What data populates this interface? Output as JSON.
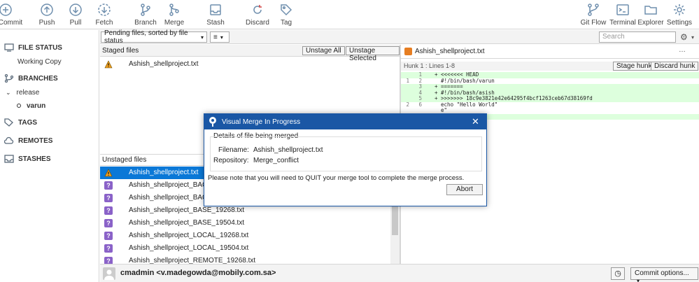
{
  "toolbar": {
    "commit": "Commit",
    "push": "Push",
    "pull": "Pull",
    "fetch": "Fetch",
    "branch": "Branch",
    "merge": "Merge",
    "stash": "Stash",
    "discard": "Discard",
    "tag": "Tag",
    "gitflow": "Git Flow",
    "terminal": "Terminal",
    "explorer": "Explorer",
    "settings": "Settings"
  },
  "sidebar": {
    "file_status": "FILE STATUS",
    "working_copy": "Working Copy",
    "branches": "BRANCHES",
    "release": "release",
    "varun": "varun",
    "tags": "TAGS",
    "remotes": "REMOTES",
    "stashes": "STASHES"
  },
  "filter": {
    "sort": "Pending files, sorted by file status",
    "search_placeholder": "Search"
  },
  "staged": {
    "header": "Staged files",
    "unstage_all": "Unstage All",
    "unstage_selected": "Unstage Selected",
    "files": [
      "Ashish_shellproject.txt"
    ]
  },
  "unstaged": {
    "header": "Unstaged files",
    "files": [
      "Ashish_shellproject.txt",
      "Ashish_shellproject_BACKUP",
      "Ashish_shellproject_BACKUP",
      "Ashish_shellproject_BASE_19268.txt",
      "Ashish_shellproject_BASE_19504.txt",
      "Ashish_shellproject_LOCAL_19268.txt",
      "Ashish_shellproject_LOCAL_19504.txt",
      "Ashish_shellproject_REMOTE_19268.txt"
    ]
  },
  "diff": {
    "file": "Ashish_shellproject.txt",
    "hunk": "Hunk 1 : Lines 1-8",
    "stage_hunk": "Stage hunk",
    "discard_hunk": "Discard hunk",
    "lines": [
      {
        "o": "",
        "n": "1",
        "t": "+ <<<<<<< HEAD",
        "add": true
      },
      {
        "o": "1",
        "n": "2",
        "t": "  #!/bin/bash/varun",
        "add": false
      },
      {
        "o": "",
        "n": "3",
        "t": "+ =======",
        "add": true
      },
      {
        "o": "",
        "n": "4",
        "t": "+ #!/bin/bash/asish",
        "add": true
      },
      {
        "o": "",
        "n": "5",
        "t": "+ >>>>>>> 18c9e3821e42e64295f4bcf1263ceb67d38169fd",
        "add": true
      },
      {
        "o": "2",
        "n": "6",
        "t": "  echo \"Hello World\"",
        "add": false
      },
      {
        "o": "",
        "n": "",
        "t": "  e\"",
        "add": false
      },
      {
        "o": "",
        "n": "",
        "t": "",
        "add": true
      }
    ]
  },
  "commit": {
    "author": "cmadmin <v.madegowda@mobily.com.sa>",
    "options": "Commit options..."
  },
  "dialog": {
    "title": "Visual Merge In Progress",
    "group": "Details of file being merged",
    "filename_label": "Filename:",
    "filename": "Ashish_shellproject.txt",
    "repo_label": "Repository:",
    "repo": "Merge_conflict",
    "note": "Please note that you will need to QUIT your merge tool to complete the merge process.",
    "abort": "Abort"
  }
}
